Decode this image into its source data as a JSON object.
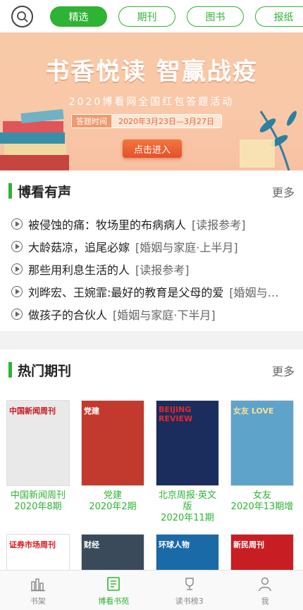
{
  "top_tabs": [
    "精选",
    "期刊",
    "图书",
    "报纸"
  ],
  "banner": {
    "title": "书香悦读 智赢战疫",
    "subtitle": "2020博看网全国红包答题活动",
    "date_label": "答题时间",
    "date_value": "2020年3月23日—3月27日",
    "button": "点击进入"
  },
  "audio_section": {
    "title": "博看有声",
    "more": "更多",
    "items": [
      {
        "title": "被侵蚀的痛：牧场里的布病病人",
        "tag": "[读报参考]"
      },
      {
        "title": "大龄菇凉，追尾必嫁",
        "tag": "[婚姻与家庭·上半月]"
      },
      {
        "title": "那些用利息生活的人",
        "tag": "[读报参考]"
      },
      {
        "title": "刘晔宏、王婉霏:最好的教育是父母的爱",
        "tag": "[婚姻与…"
      },
      {
        "title": "做孩子的合伙人",
        "tag": "[婚姻与家庭·下半月]"
      }
    ]
  },
  "magazine_section": {
    "title": "热门期刊",
    "more": "更多",
    "items": [
      {
        "name": "中国新闻周刊",
        "issue": "2020年8期",
        "cover_text": "中国新闻周刊",
        "cover_color": "#e9e9e9",
        "title_color": "#c8161d"
      },
      {
        "name": "党建",
        "issue": "2020年2期",
        "cover_text": "党建",
        "cover_color": "#c23a2e",
        "title_color": "#ffffff"
      },
      {
        "name": "北京周报·英文版",
        "issue": "2020年11期",
        "cover_text": "BEIJING REVIEW",
        "cover_color": "#1a2d5c",
        "title_color": "#e8262a"
      },
      {
        "name": "女友",
        "issue": "2020年13期增",
        "cover_text": "女友 LOVE",
        "cover_color": "#5ea3c9",
        "title_color": "#f5e29a"
      },
      {
        "name": "",
        "issue": "",
        "cover_text": "证券市场周刊",
        "cover_color": "#ffffff",
        "title_color": "#d8161b"
      },
      {
        "name": "",
        "issue": "",
        "cover_text": "财经",
        "cover_color": "#3b4a5a",
        "title_color": "#ffffff"
      },
      {
        "name": "",
        "issue": "",
        "cover_text": "环球人物",
        "cover_color": "#1a6aa8",
        "title_color": "#ffffff"
      },
      {
        "name": "",
        "issue": "",
        "cover_text": "新民周刊",
        "cover_color": "#c91d24",
        "title_color": "#ffffff"
      }
    ]
  },
  "bottom_nav": [
    {
      "label": "书架",
      "icon": "bookshelf-icon"
    },
    {
      "label": "博看书苑",
      "icon": "book-icon"
    },
    {
      "label": "读书榜3",
      "icon": "trophy-icon"
    },
    {
      "label": "我",
      "icon": "user-icon"
    }
  ],
  "colors": {
    "accent": "#2fb334"
  }
}
